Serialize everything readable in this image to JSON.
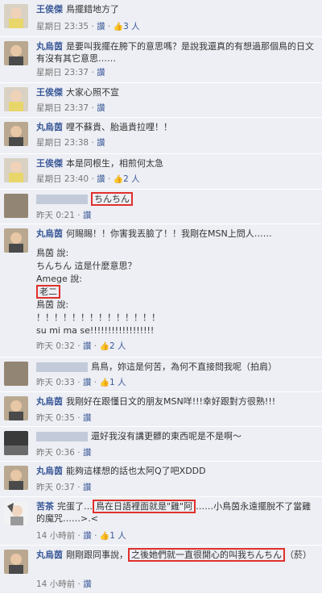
{
  "comments": [
    {
      "name": "王俟傑",
      "text": "鳥擺錯地方了",
      "time": "星期日 23:35",
      "sep": "·",
      "likes": "3 人"
    },
    {
      "name": "丸烏茵",
      "text": "是要叫我擺在胯下的意思嗎？是說我還真的有想過那個鳥的日文有沒有其它意思……",
      "time": "星期日 23:37",
      "sep": "·",
      "likes": ""
    },
    {
      "name": "王俟傑",
      "text": "大家心照不宣",
      "time": "星期日 23:37",
      "sep": "·",
      "likes": ""
    },
    {
      "name": "丸烏茵",
      "text": "哩不蘇貴、胎過貴拉哩！！",
      "time": "星期日 23:38",
      "sep": "·",
      "likes": ""
    },
    {
      "name": "王俟傑",
      "text": "本是同根生，相煎何太急",
      "time": "星期日 23:40",
      "sep": "·",
      "likes": "2 人"
    },
    {
      "name": "",
      "text": "ちんちん",
      "time": "昨天 0:21",
      "sep": "·",
      "likes": ""
    },
    {
      "name": "丸烏茵",
      "text": "何賜賜！！你害我丟臉了！！我剛在MSN上問人……",
      "time": "昨天 0:32",
      "sep": "·",
      "likes": "2 人",
      "extra": [
        "鳥茵 說:",
        "ちんちん 這是什麼意思？",
        "Amege 說:",
        "老二",
        "鳥茵 說:",
        "！！！！！！！！！！！！！！",
        "su mi ma se!!!!!!!!!!!!!!!!!!"
      ]
    },
    {
      "name": "",
      "text": "鳥鳥，妳這是何苦，為何不直接問我呢（拍肩）",
      "time": "昨天 0:33",
      "sep": "·",
      "likes": "1 人"
    },
    {
      "name": "丸烏茵",
      "text": "我剛好在跟懂日文的朋友MSN咩!!!幸好跟對方很熟!!!",
      "time": "昨天 0:35",
      "sep": "·",
      "likes": ""
    },
    {
      "name": "",
      "text": "還好我沒有講更髒的東西呢是不是啊～",
      "time": "昨天 0:36",
      "sep": "·",
      "likes": ""
    },
    {
      "name": "丸烏茵",
      "text": "能夠這樣想的話也太阿Q了吧XDDD",
      "time": "昨天 0:37",
      "sep": "·",
      "likes": ""
    },
    {
      "name": "苦茶",
      "text_pre": "完蛋了…",
      "text_box": "鳥在日語裡面就是\"雞\"阿",
      "text_post": "……小鳥茵永遠擺脫不了當雞的魔咒……>.<",
      "time": "14 小時前",
      "sep": "·",
      "likes": "1 人"
    },
    {
      "name": "丸烏茵",
      "text_pre": "剛剛跟同事說，",
      "text_box": "之後她們就一直很開心的叫我ちんちん",
      "text_post": "（菸）",
      "time": "14 小時前",
      "sep": "·",
      "likes": ""
    }
  ],
  "ui": {
    "reply": "讚",
    "thumb_icon": "like-thumb-icon"
  },
  "colors": {
    "bg": "#edeff4",
    "link": "#3b5998",
    "highlight": "#e0302b"
  }
}
